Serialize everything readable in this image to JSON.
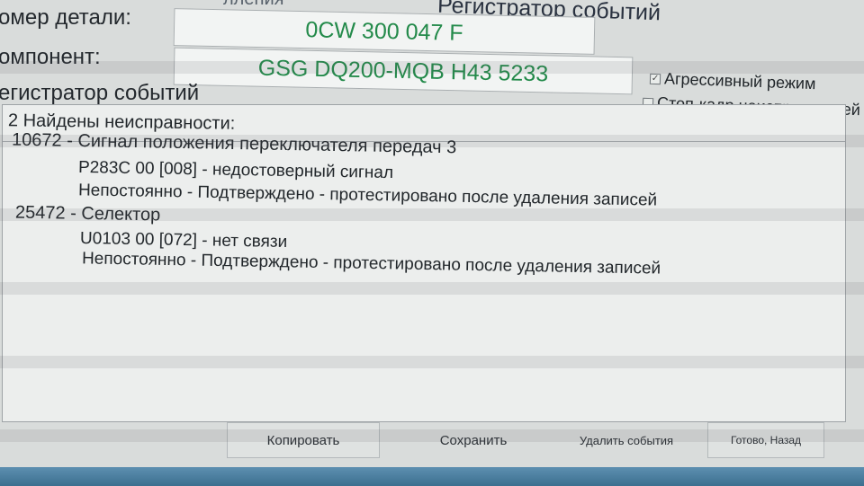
{
  "header": {
    "title": "Регистратор событий",
    "title_cut": "лления"
  },
  "labels": {
    "part_number": "омер детали:",
    "component": "омпонент:",
    "log_section": "егистратор событий"
  },
  "fields": {
    "part_number_value": "0CW 300 047 F",
    "component_value": "GSG DQ200-MQB H43 5233"
  },
  "options": {
    "aggressive_mode": {
      "label": "Агрессивный режим",
      "checked": true
    },
    "freeze_frame": {
      "label": "Стоп-кадр неисправностей",
      "checked": false
    }
  },
  "log": {
    "header": "2 Найдены неисправности:",
    "entries": [
      {
        "fault": "10672 - Сигнал положения переключателя передач 3",
        "code": "P283C 00 [008] - недостоверный сигнал",
        "status": "Непостоянно - Подтверждено - протестировано после удаления записей"
      },
      {
        "fault": "25472 - Селектор",
        "code": "U0103 00 [072] - нет связи",
        "status": "Непостоянно - Подтверждено - протестировано после удаления записей"
      }
    ]
  },
  "buttons": {
    "copy": "Копировать",
    "save": "Сохранить",
    "delete_events": "Удалить события",
    "done_back": "Готово, Назад"
  },
  "colors": {
    "field_text": "#238a4a",
    "taskbar": "#4a7d9e"
  }
}
